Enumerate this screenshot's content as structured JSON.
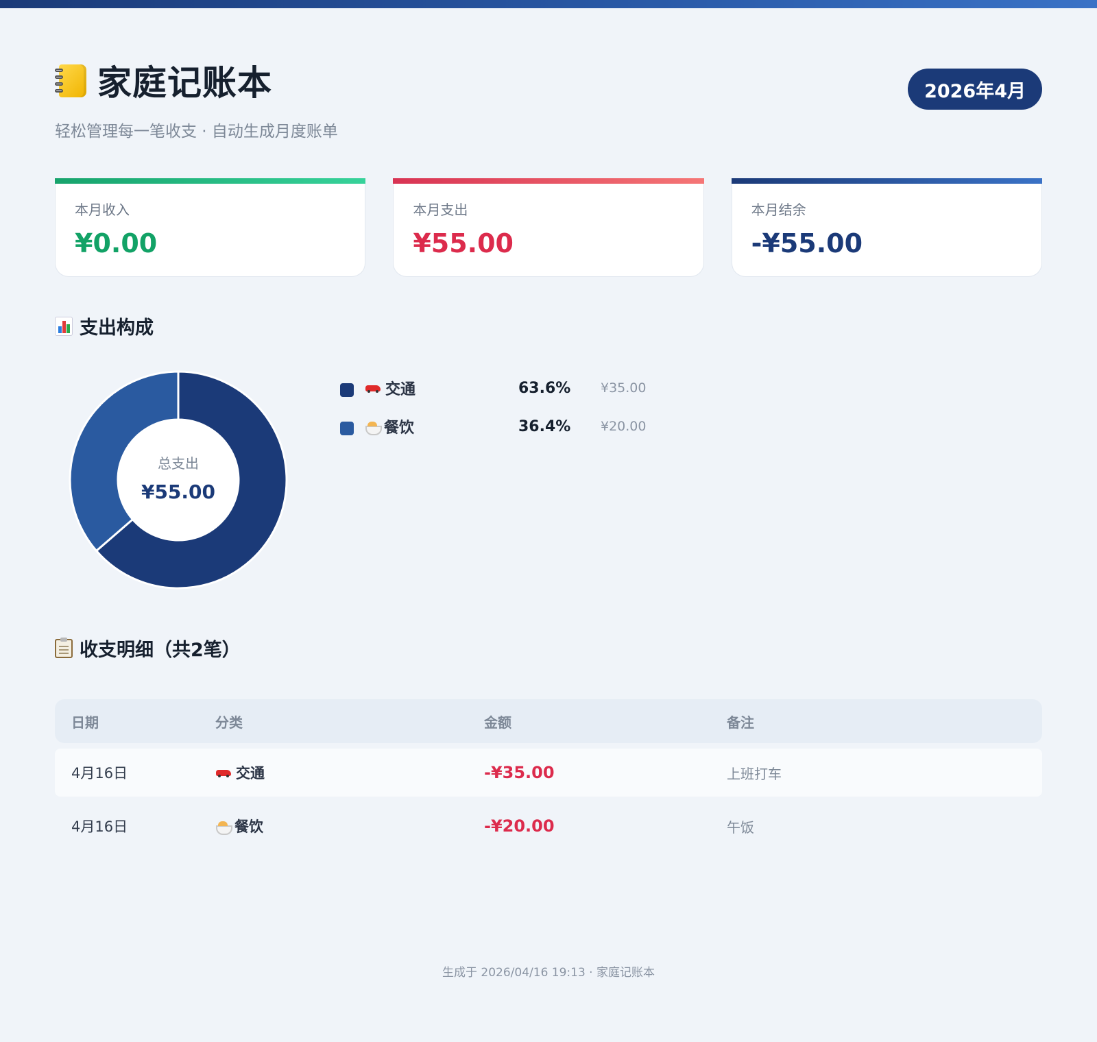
{
  "header": {
    "title": "家庭记账本",
    "subtitle": "轻松管理每一笔收支 · 自动生成月度账单",
    "month": "2026年4月"
  },
  "summary": {
    "income_label": "本月收入",
    "income_value": "¥0.00",
    "expense_label": "本月支出",
    "expense_value": "¥55.00",
    "balance_label": "本月结余",
    "balance_value": "-¥55.00"
  },
  "composition": {
    "title": "支出构成",
    "center_label": "总支出",
    "center_value": "¥55.00"
  },
  "chart_data": {
    "type": "pie",
    "categories": [
      "交通",
      "餐饮"
    ],
    "values": [
      35.0,
      20.0
    ],
    "percentages": [
      "63.6%",
      "36.4%"
    ],
    "amounts": [
      "¥35.00",
      "¥20.00"
    ],
    "icons": [
      "car-icon",
      "noodle-icon"
    ],
    "colors": [
      "#1b3a78",
      "#2a5aa0"
    ]
  },
  "details": {
    "title": "收支明细（共2笔）",
    "columns": [
      "日期",
      "分类",
      "金额",
      "备注"
    ],
    "rows": [
      {
        "date": "4月16日",
        "category": "交通",
        "icon": "car-icon",
        "amount": "-¥35.00",
        "note": "上班打车"
      },
      {
        "date": "4月16日",
        "category": "餐饮",
        "icon": "noodle-icon",
        "amount": "-¥20.00",
        "note": "午饭"
      }
    ]
  },
  "footer": {
    "text": "生成于 2026/04/16 19:13 · 家庭记账本"
  },
  "colors": {
    "accent": "#1b3a78",
    "income": "#12a266",
    "expense": "#dc2b4c",
    "background": "#f0f4f9"
  }
}
